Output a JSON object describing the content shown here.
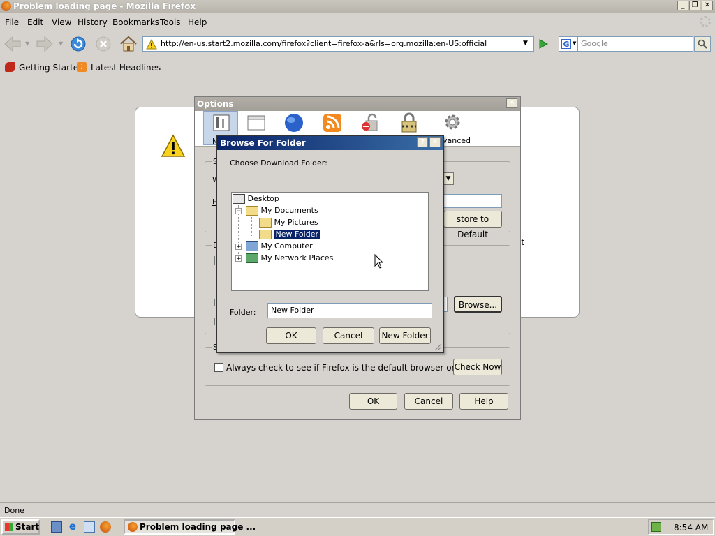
{
  "window": {
    "title": "Problem loading page - Mozilla Firefox"
  },
  "menus": [
    "File",
    "Edit",
    "View",
    "History",
    "Bookmarks",
    "Tools",
    "Help"
  ],
  "nav": {
    "url": "http://en-us.start2.mozilla.com/firefox?client=firefox-a&rls=org.mozilla:en-US:official",
    "search_placeholder": "Google"
  },
  "bookmarks": [
    "Getting Started",
    "Latest Headlines"
  ],
  "options_dialog": {
    "title": "Options",
    "tabs": [
      {
        "label": "M",
        "icon": "main-icon"
      },
      {
        "label": "",
        "icon": "tabs-icon"
      },
      {
        "label": "",
        "icon": "content-icon"
      },
      {
        "label": "",
        "icon": "feeds-icon"
      },
      {
        "label": "",
        "icon": "privacy-icon"
      },
      {
        "label": "",
        "icon": "security-icon"
      },
      {
        "label": "dvanced",
        "icon": "advanced-icon"
      }
    ],
    "startup_group_label": "S",
    "when_label": "W",
    "home_label": "H",
    "restore_label": "store to Default",
    "downloads_group_label": "D",
    "browse_button": "Browse...",
    "system_group_label": "S",
    "default_check_label": "Always check to see if Firefox is the default browser on startup",
    "check_now_button": "Check Now",
    "ok": "OK",
    "cancel": "Cancel",
    "help": "Help",
    "partial_text": "at"
  },
  "browse_dialog": {
    "title": "Browse For Folder",
    "prompt": "Choose Download Folder:",
    "tree": {
      "desktop": "Desktop",
      "my_documents": "My Documents",
      "my_pictures": "My Pictures",
      "new_folder": "New Folder",
      "my_computer": "My Computer",
      "my_network_places": "My Network Places"
    },
    "folder_label": "Folder:",
    "folder_value": "New Folder",
    "ok": "OK",
    "cancel": "Cancel",
    "new_folder_button": "New Folder"
  },
  "status": {
    "text": "Done"
  },
  "taskbar": {
    "start": "Start",
    "task": "Problem loading page ...",
    "clock": "8:54 AM"
  }
}
